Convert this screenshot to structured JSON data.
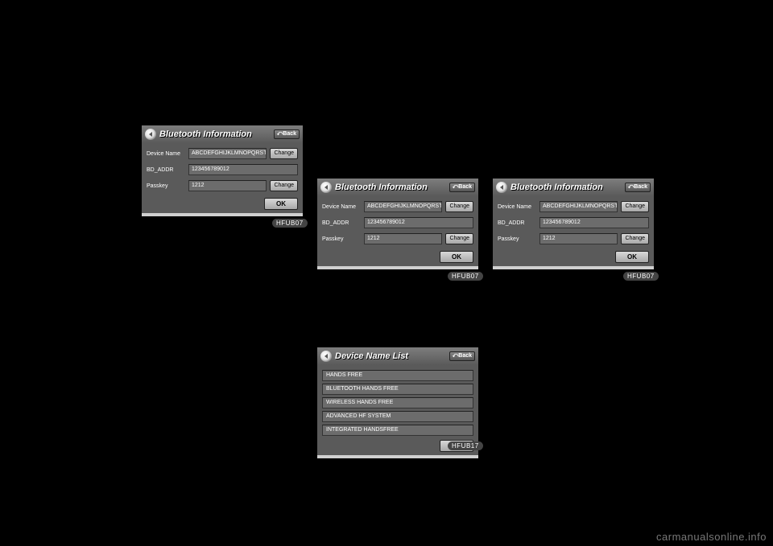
{
  "labels": {
    "back": "⤺Back",
    "change": "Change",
    "ok": "OK",
    "device_name": "Device Name",
    "bd_addr": "BD_ADDR",
    "passkey": "Passkey"
  },
  "bt_info_title": "Bluetooth Information",
  "device_list_title": "Device Name List",
  "bt": {
    "device_name": "ABCDEFGHIJKLMNOPQRST",
    "bd_addr": "123456789012",
    "passkey": "1212"
  },
  "device_list": [
    "HANDS FREE",
    "BLUETOOTH HANDS FREE",
    "WIRELESS HANDS FREE",
    "ADVANCED HF SYSTEM",
    "INTEGRATED HANDSFREE"
  ],
  "figcodes": {
    "p1": "HFUB07",
    "p2": "HFUB07",
    "p3": "HFUB07",
    "p4": "HFUB17"
  },
  "watermark": "carmanualsonline.info"
}
